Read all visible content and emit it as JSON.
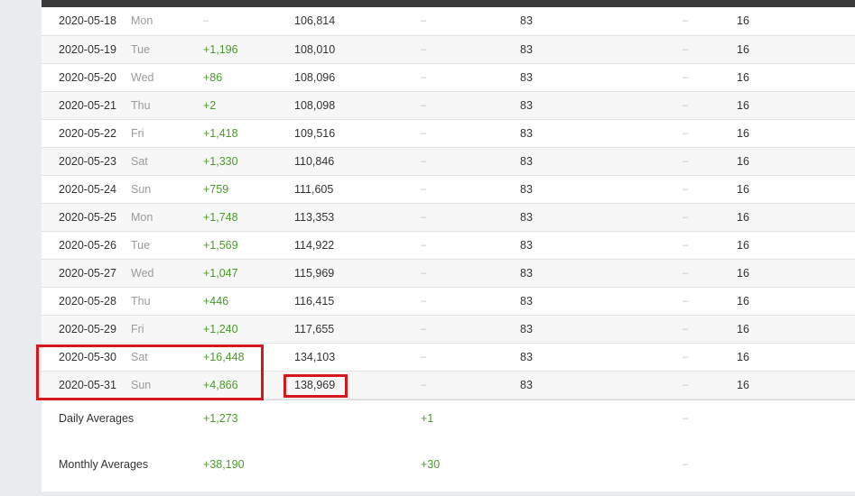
{
  "rows": [
    {
      "date": "2020-05-18",
      "day": "Mon",
      "change": "–",
      "total": "106,814",
      "d2": "–",
      "v2": "83",
      "d3": "–",
      "v3": "16"
    },
    {
      "date": "2020-05-19",
      "day": "Tue",
      "change": "+1,196",
      "total": "108,010",
      "d2": "–",
      "v2": "83",
      "d3": "–",
      "v3": "16"
    },
    {
      "date": "2020-05-20",
      "day": "Wed",
      "change": "+86",
      "total": "108,096",
      "d2": "–",
      "v2": "83",
      "d3": "–",
      "v3": "16"
    },
    {
      "date": "2020-05-21",
      "day": "Thu",
      "change": "+2",
      "total": "108,098",
      "d2": "–",
      "v2": "83",
      "d3": "–",
      "v3": "16"
    },
    {
      "date": "2020-05-22",
      "day": "Fri",
      "change": "+1,418",
      "total": "109,516",
      "d2": "–",
      "v2": "83",
      "d3": "–",
      "v3": "16"
    },
    {
      "date": "2020-05-23",
      "day": "Sat",
      "change": "+1,330",
      "total": "110,846",
      "d2": "–",
      "v2": "83",
      "d3": "–",
      "v3": "16"
    },
    {
      "date": "2020-05-24",
      "day": "Sun",
      "change": "+759",
      "total": "111,605",
      "d2": "–",
      "v2": "83",
      "d3": "–",
      "v3": "16"
    },
    {
      "date": "2020-05-25",
      "day": "Mon",
      "change": "+1,748",
      "total": "113,353",
      "d2": "–",
      "v2": "83",
      "d3": "–",
      "v3": "16"
    },
    {
      "date": "2020-05-26",
      "day": "Tue",
      "change": "+1,569",
      "total": "114,922",
      "d2": "–",
      "v2": "83",
      "d3": "–",
      "v3": "16"
    },
    {
      "date": "2020-05-27",
      "day": "Wed",
      "change": "+1,047",
      "total": "115,969",
      "d2": "–",
      "v2": "83",
      "d3": "–",
      "v3": "16"
    },
    {
      "date": "2020-05-28",
      "day": "Thu",
      "change": "+446",
      "total": "116,415",
      "d2": "–",
      "v2": "83",
      "d3": "–",
      "v3": "16"
    },
    {
      "date": "2020-05-29",
      "day": "Fri",
      "change": "+1,240",
      "total": "117,655",
      "d2": "–",
      "v2": "83",
      "d3": "–",
      "v3": "16"
    },
    {
      "date": "2020-05-30",
      "day": "Sat",
      "change": "+16,448",
      "total": "134,103",
      "d2": "–",
      "v2": "83",
      "d3": "–",
      "v3": "16"
    },
    {
      "date": "2020-05-31",
      "day": "Sun",
      "change": "+4,866",
      "total": "138,969",
      "d2": "–",
      "v2": "83",
      "d3": "–",
      "v3": "16"
    }
  ],
  "averages": {
    "daily": {
      "label": "Daily Averages",
      "change": "+1,273",
      "growth": "+1",
      "dash": "–"
    },
    "monthly": {
      "label": "Monthly Averages",
      "change": "+38,190",
      "growth": "+30",
      "dash": "–"
    }
  },
  "colors": {
    "positive": "#4a9a2a",
    "highlight": "#d9161c",
    "header_bar": "#3a3a3a"
  }
}
